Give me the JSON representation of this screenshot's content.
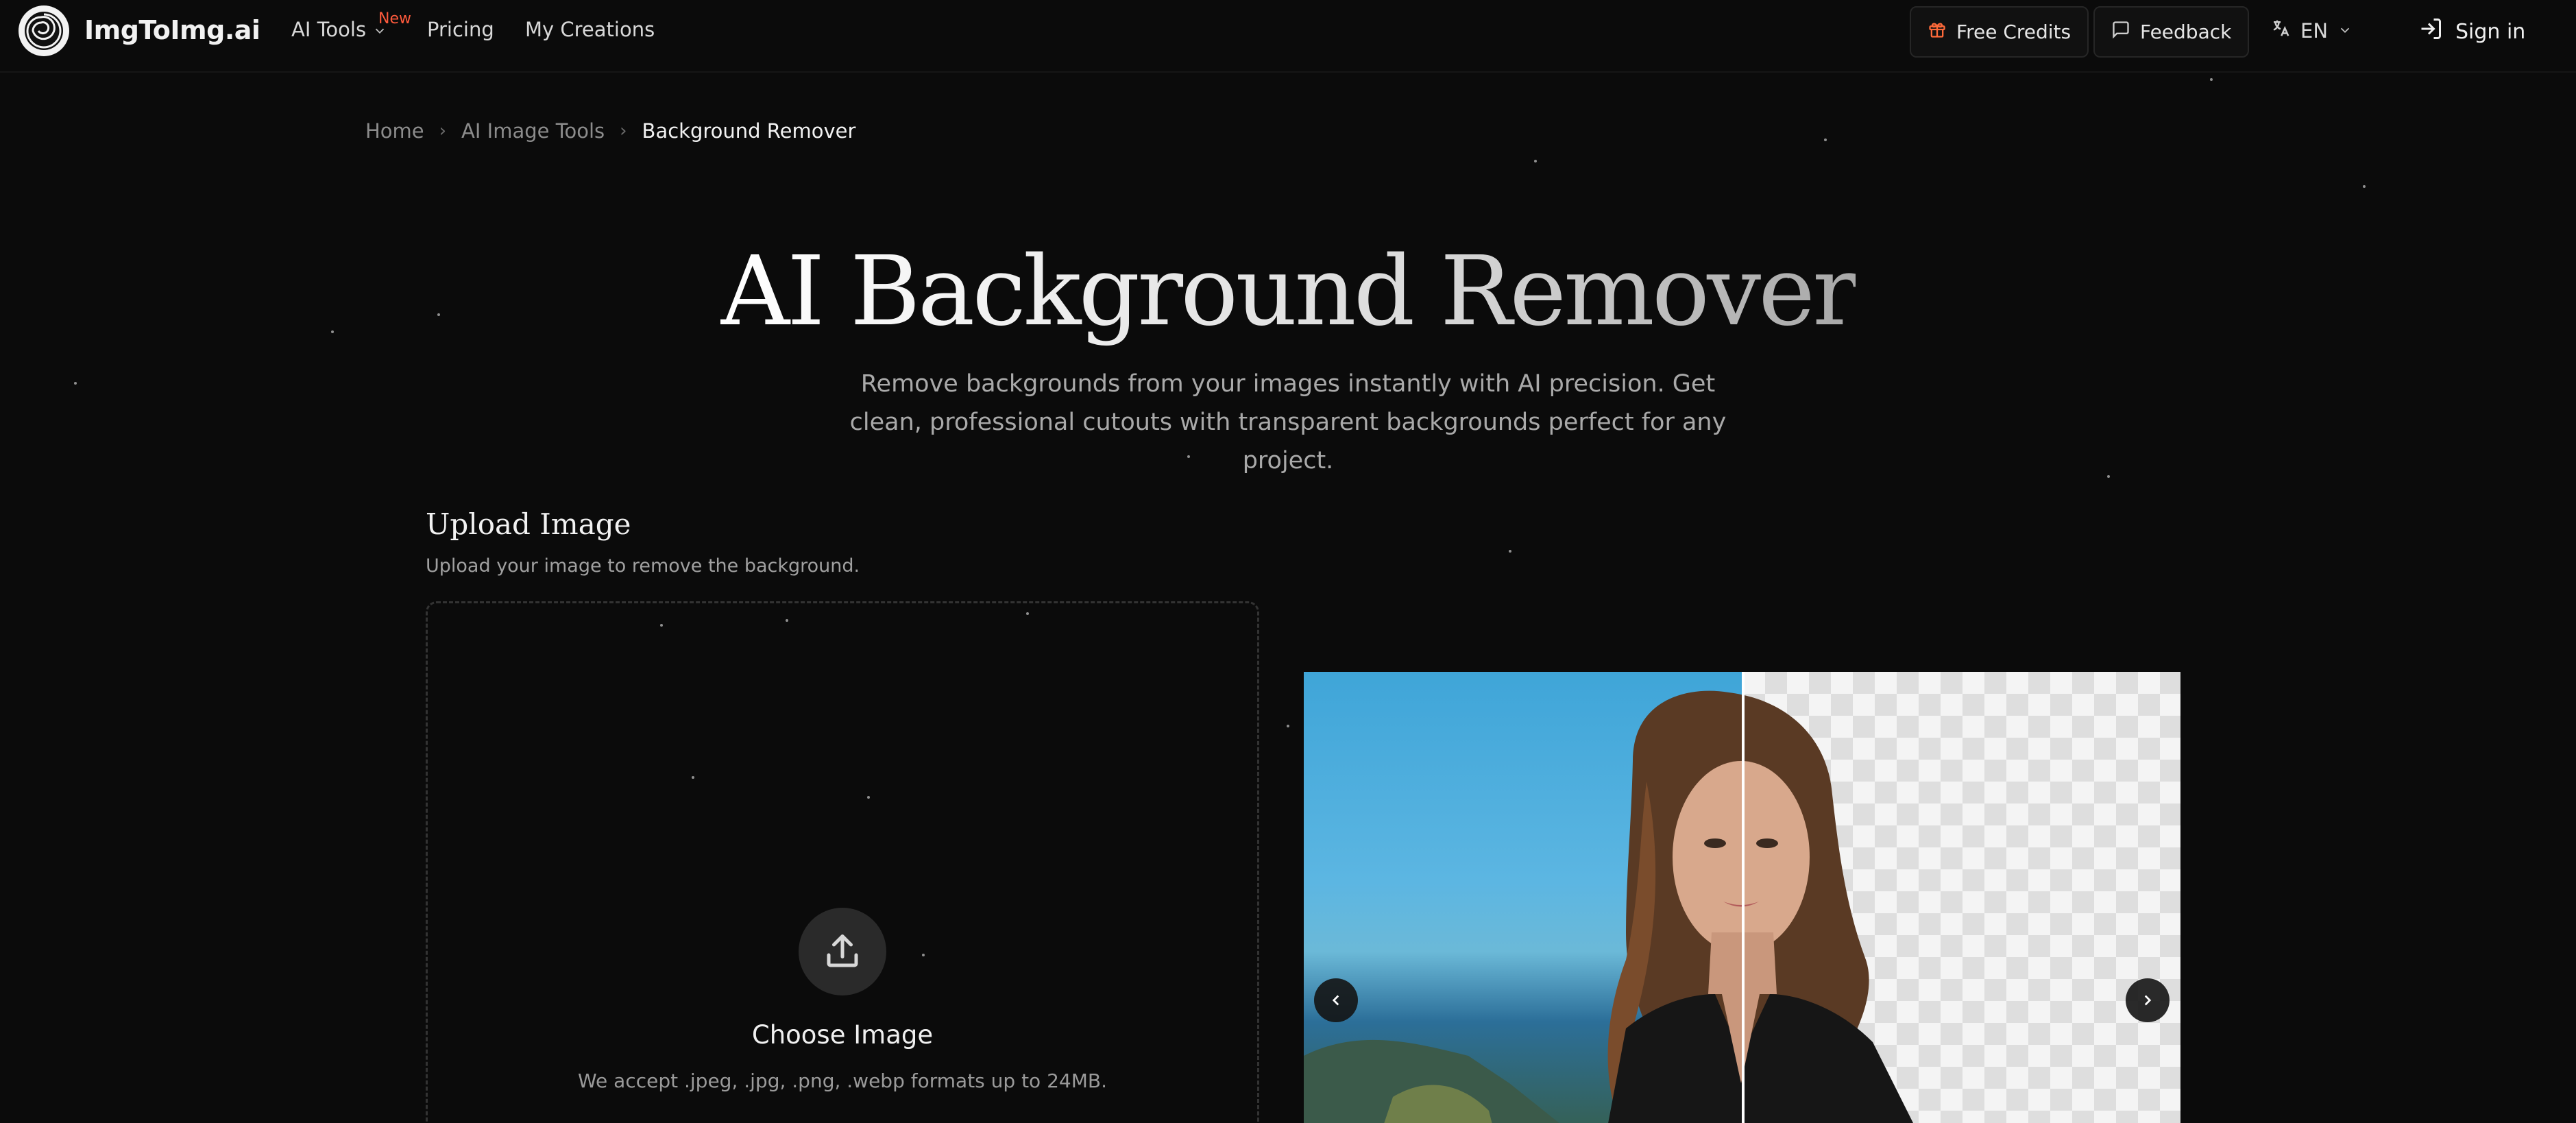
{
  "nav": {
    "brand": "ImgToImg.ai",
    "links": [
      {
        "label": "AI Tools",
        "badge": "New"
      },
      {
        "label": "Pricing"
      },
      {
        "label": "My Creations"
      }
    ],
    "free_credits_label": "Free Credits",
    "feedback_label": "Feedback",
    "language": "EN",
    "signin_label": "Sign in"
  },
  "breadcrumb": {
    "items": [
      "Home",
      "AI Image Tools",
      "Background Remover"
    ]
  },
  "hero": {
    "title": "AI Background Remover",
    "subtitle": "Remove backgrounds from your images instantly with AI precision. Get clean, professional cutouts with transparent backgrounds perfect for any project."
  },
  "upload": {
    "title": "Upload Image",
    "description": "Upload your image to remove the background.",
    "choose_label": "Choose Image",
    "accept_text": "We accept .jpeg, .jpg, .png, .webp formats up to 24MB."
  },
  "colors": {
    "background": "#0b0b0b",
    "accent_badge": "#ff5a3c",
    "credits_icon": "#ff6a3a"
  },
  "icons": {
    "logo": "spiral-logo-icon",
    "dropdown": "chevron-down-icon",
    "credits": "gift-icon",
    "feedback": "message-square-icon",
    "language": "translate-icon",
    "signin": "log-in-icon",
    "upload": "upload-icon",
    "prev": "chevron-left-icon",
    "next": "chevron-right-icon"
  }
}
